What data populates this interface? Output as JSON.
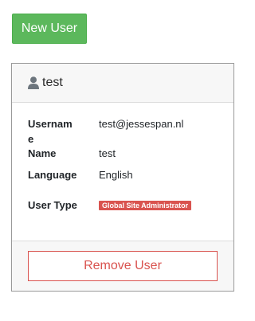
{
  "toolbar": {
    "new_user_label": "New User"
  },
  "user_card": {
    "header_icon": "user-icon",
    "header_name": "test",
    "fields": {
      "username_label": "Username",
      "username_value": "test@jessespan.nl",
      "name_label": "Name",
      "name_value": "test",
      "language_label": "Language",
      "language_value": "English",
      "user_type_label": "User Type",
      "user_type_badge": "Global Site Administrator"
    },
    "remove_label": "Remove User"
  },
  "colors": {
    "success": "#5cb85c",
    "danger": "#d9534f",
    "card_bg": "#f7f7f7"
  }
}
